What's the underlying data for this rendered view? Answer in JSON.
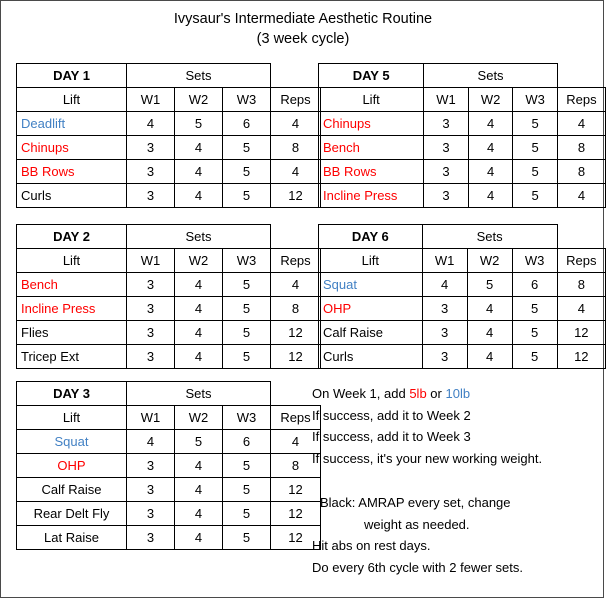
{
  "header": {
    "title": "Ivysaur's Intermediate Aesthetic Routine",
    "subtitle": "(3 week cycle)"
  },
  "colors": {
    "primary_lift": "#4281c4",
    "secondary_lift": "#fe0000",
    "accessory_lift": "#000000",
    "border": "#000000",
    "page_border": "#4a4a4a"
  },
  "table_headers": {
    "sets": "Sets",
    "lift": "Lift",
    "w1": "W1",
    "w2": "W2",
    "w3": "W3",
    "reps": "Reps",
    "blank": ""
  },
  "days": [
    {
      "id": "day1",
      "title": "DAY 1",
      "align": "left",
      "rows": [
        {
          "lift": "Deadlift",
          "color": "blue",
          "w1": "4",
          "w2": "5",
          "w3": "6",
          "reps": "4"
        },
        {
          "lift": "Chinups",
          "color": "red",
          "w1": "3",
          "w2": "4",
          "w3": "5",
          "reps": "8"
        },
        {
          "lift": "BB Rows",
          "color": "red",
          "w1": "3",
          "w2": "4",
          "w3": "5",
          "reps": "4"
        },
        {
          "lift": "Curls",
          "color": "black",
          "w1": "3",
          "w2": "4",
          "w3": "5",
          "reps": "12"
        }
      ]
    },
    {
      "id": "day2",
      "title": "DAY 2",
      "align": "left",
      "rows": [
        {
          "lift": "Bench",
          "color": "red",
          "w1": "3",
          "w2": "4",
          "w3": "5",
          "reps": "4"
        },
        {
          "lift": "Incline Press",
          "color": "red",
          "w1": "3",
          "w2": "4",
          "w3": "5",
          "reps": "8"
        },
        {
          "lift": "Flies",
          "color": "black",
          "w1": "3",
          "w2": "4",
          "w3": "5",
          "reps": "12"
        },
        {
          "lift": "Tricep Ext",
          "color": "black",
          "w1": "3",
          "w2": "4",
          "w3": "5",
          "reps": "12"
        }
      ]
    },
    {
      "id": "day3",
      "title": "DAY 3",
      "align": "center",
      "rows": [
        {
          "lift": "Squat",
          "color": "blue",
          "w1": "4",
          "w2": "5",
          "w3": "6",
          "reps": "4"
        },
        {
          "lift": "OHP",
          "color": "red",
          "w1": "3",
          "w2": "4",
          "w3": "5",
          "reps": "8"
        },
        {
          "lift": "Calf Raise",
          "color": "black",
          "w1": "3",
          "w2": "4",
          "w3": "5",
          "reps": "12"
        },
        {
          "lift": "Rear Delt Fly",
          "color": "black",
          "w1": "3",
          "w2": "4",
          "w3": "5",
          "reps": "12"
        },
        {
          "lift": "Lat Raise",
          "color": "black",
          "w1": "3",
          "w2": "4",
          "w3": "5",
          "reps": "12"
        }
      ]
    },
    {
      "id": "day5",
      "title": "DAY 5",
      "align": "left",
      "rows": [
        {
          "lift": "Chinups",
          "color": "red",
          "w1": "3",
          "w2": "4",
          "w3": "5",
          "reps": "4"
        },
        {
          "lift": "Bench",
          "color": "red",
          "w1": "3",
          "w2": "4",
          "w3": "5",
          "reps": "8"
        },
        {
          "lift": "BB Rows",
          "color": "red",
          "w1": "3",
          "w2": "4",
          "w3": "5",
          "reps": "8"
        },
        {
          "lift": "Incline Press",
          "color": "red",
          "w1": "3",
          "w2": "4",
          "w3": "5",
          "reps": "4"
        }
      ]
    },
    {
      "id": "day6",
      "title": "DAY 6",
      "align": "left",
      "rows": [
        {
          "lift": "Squat",
          "color": "blue",
          "w1": "4",
          "w2": "5",
          "w3": "6",
          "reps": "8"
        },
        {
          "lift": "OHP",
          "color": "red",
          "w1": "3",
          "w2": "4",
          "w3": "5",
          "reps": "4"
        },
        {
          "lift": "Calf Raise",
          "color": "black",
          "w1": "3",
          "w2": "4",
          "w3": "5",
          "reps": "12"
        },
        {
          "lift": "Curls",
          "color": "black",
          "w1": "3",
          "w2": "4",
          "w3": "5",
          "reps": "12"
        }
      ]
    }
  ],
  "notes": {
    "progression": {
      "line1_a": "On Week 1, add ",
      "line1_red": "5lb",
      "line1_b": " or ",
      "line1_blue": "10lb",
      "line2": "If success, add it to Week 2",
      "line3": "If success, add it to Week 3",
      "line4": "If success, it's your new working weight."
    },
    "general": {
      "line1": "Black: AMRAP every set, change",
      "line2": "weight as needed.",
      "line3": "Hit abs on rest days.",
      "line4": "Do every 6th cycle with 2 fewer sets."
    }
  }
}
